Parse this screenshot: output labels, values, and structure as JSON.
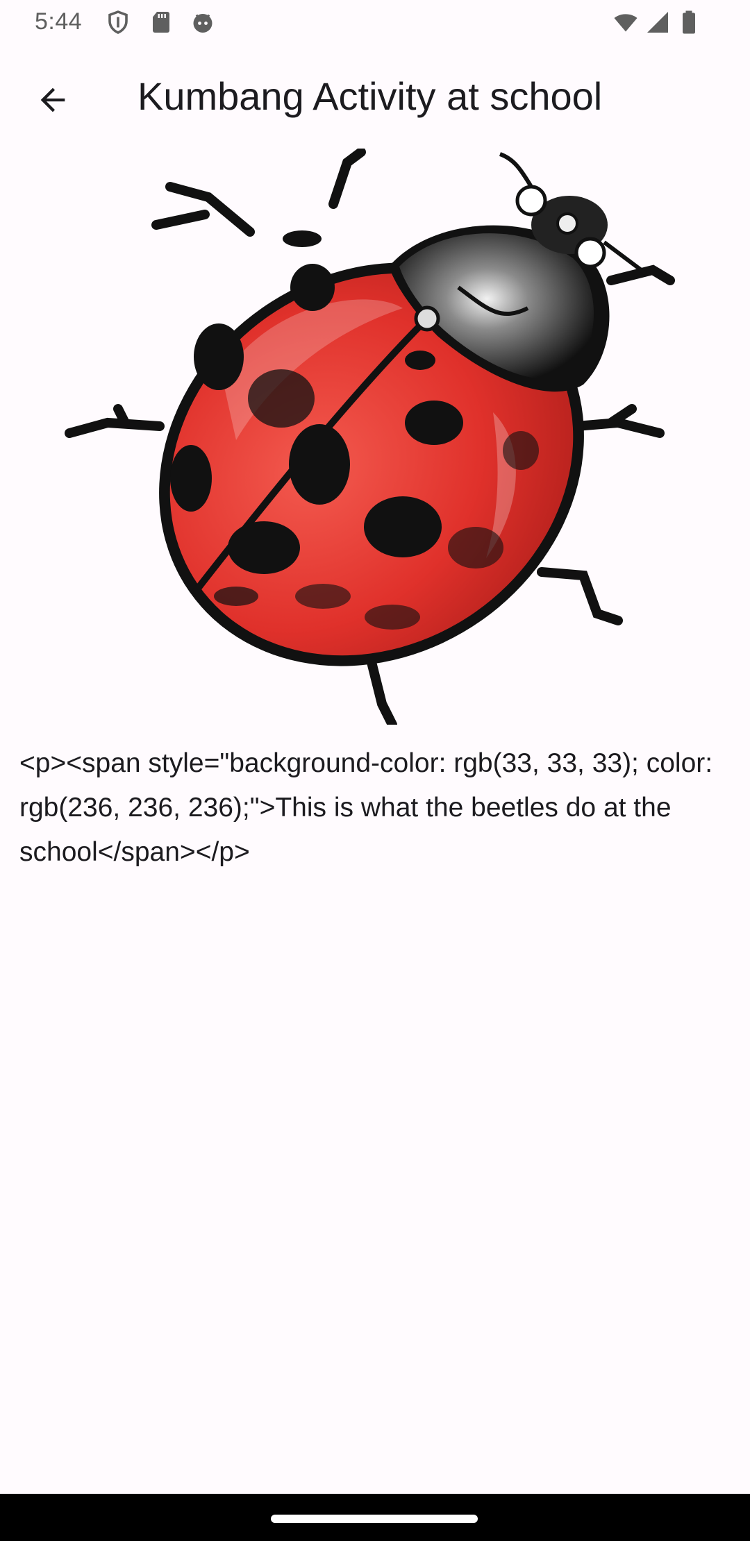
{
  "status_bar": {
    "time": "5:44",
    "icons": [
      "shield-icon",
      "sd-card-icon",
      "android-face-icon",
      "wifi-icon",
      "cellular-signal-icon",
      "battery-icon"
    ]
  },
  "app_bar": {
    "back_icon": "arrow-back-icon",
    "title": "Kumbang Activity at school"
  },
  "content": {
    "image": "ladybug-illustration",
    "body": "<p><span style=\"background-color: rgb(33, 33, 33); color: rgb(236, 236, 236);\">This is what the beetles do at the school</span></p>"
  },
  "colors": {
    "background": "#fffbfe",
    "text": "#1c1b1f",
    "nav_bar": "#000000",
    "ladybug_red": "#e0312b"
  }
}
